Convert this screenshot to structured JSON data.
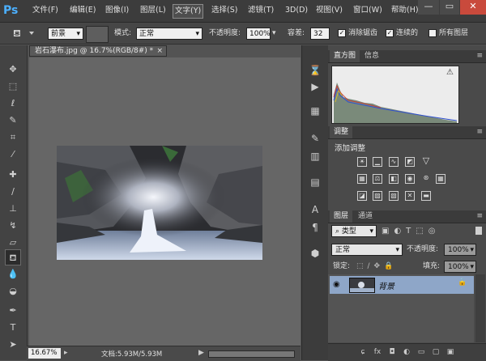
{
  "app": {
    "logo": "Ps"
  },
  "menu": [
    "文件(F)",
    "编辑(E)",
    "图像(I)",
    "图层(L)",
    "文字(Y)",
    "选择(S)",
    "滤镜(T)",
    "3D(D)",
    "视图(V)",
    "窗口(W)",
    "帮助(H)"
  ],
  "window_controls": {
    "minimize": "—",
    "restore": "▭",
    "close": "✕"
  },
  "options": {
    "fill_source": "前景",
    "mode_label": "模式:",
    "mode_value": "正常",
    "opacity_label": "不透明度:",
    "opacity_value": "100%",
    "tolerance_label": "容差:",
    "tolerance_value": "32",
    "antialias_label": "消除锯齿",
    "contiguous_label": "连续的",
    "all_layers_label": "所有图层"
  },
  "document": {
    "tab_title": "岩石瀑布.jpg @ 16.7%(RGB/8#) *",
    "zoom": "16.67%",
    "doc_info": "文档:5.93M/5.93M"
  },
  "panels": {
    "histogram_tab": "直方图",
    "info_tab": "信息",
    "adjustments_tab": "调整",
    "add_adjustment": "添加调整",
    "layers_tab": "图层",
    "channels_tab": "通道",
    "kind_filter": "类型",
    "blend_mode": "正常",
    "opacity_label": "不透明度:",
    "opacity_value": "100%",
    "lock_label": "锁定:",
    "fill_label": "填充:",
    "fill_value": "100%",
    "layer_name": "背景"
  },
  "icons": {
    "warning": "⚠",
    "eye": "◉",
    "lock": "🔒",
    "link": "ɕ"
  },
  "colors": {
    "accent": "#4cb0ff",
    "selected_layer": "#8ea6c8"
  }
}
